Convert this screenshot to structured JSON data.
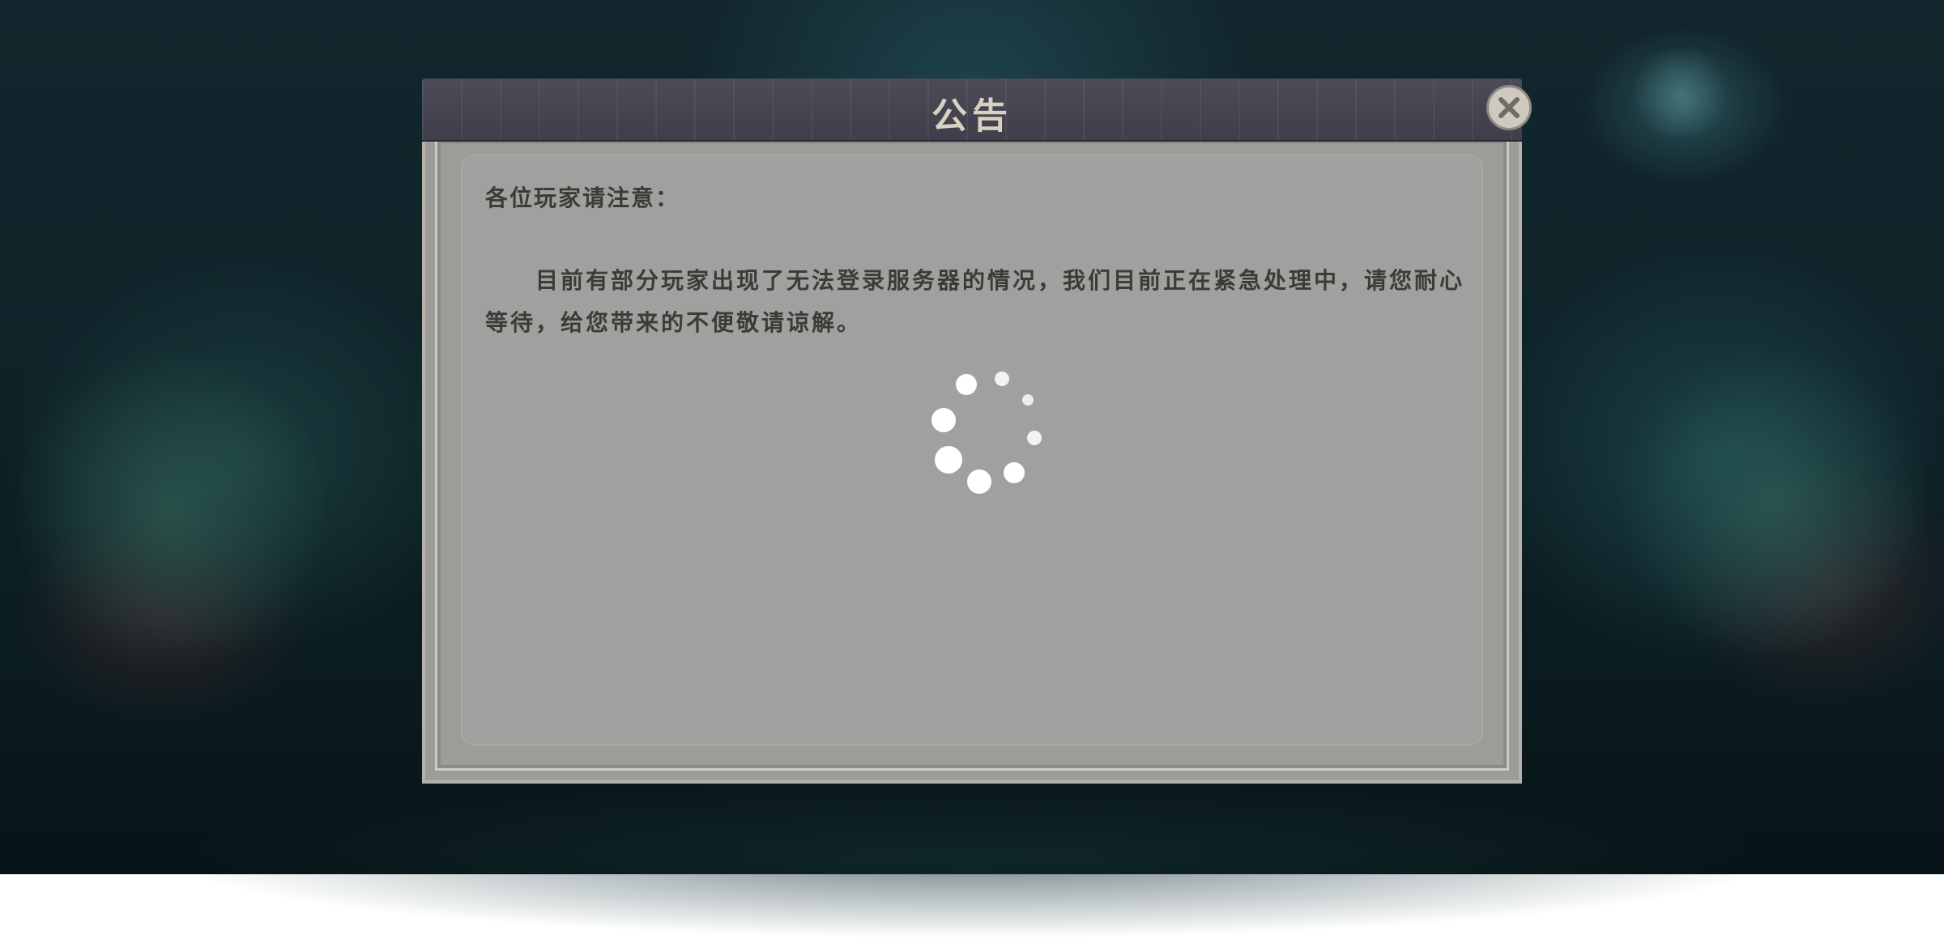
{
  "dialog": {
    "title": "公告",
    "close_icon": "close-icon",
    "greeting": "各位玩家请注意：",
    "body": "目前有部分玩家出现了无法登录服务器的情况，我们目前正在紧急处理中，请您耐心等待，给您带来的不便敬请谅解。",
    "loading_icon": "loading-spinner-icon"
  },
  "colors": {
    "title_bar": "#454452",
    "title_text": "#d8d2c3",
    "panel_bg": "#a0a09e",
    "body_text": "#3c3b38"
  }
}
